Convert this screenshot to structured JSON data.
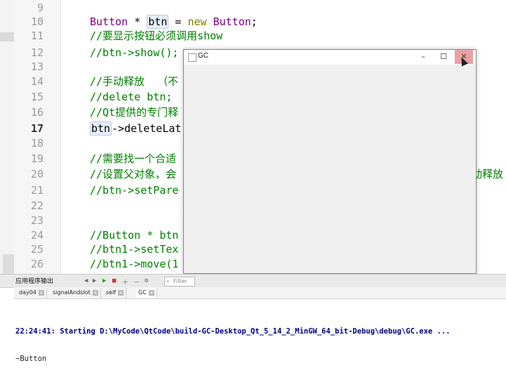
{
  "editor": {
    "line_numbers": [
      "9",
      "10",
      "11",
      "12",
      "13",
      "14",
      "15",
      "16",
      "17",
      "18",
      "19",
      "20",
      "21",
      "22",
      "23",
      "24",
      "25",
      "26"
    ],
    "current_line": "17",
    "lines": {
      "l10_type": "Button",
      "l10_op1": " * ",
      "l10_var": "btn",
      "l10_op2": " = ",
      "l10_new": "new",
      "l10_type2": " Button",
      "l10_end": ";",
      "l11": "//要显示按钮必须调用show",
      "l12": "//btn->show();",
      "l14": "//手动释放  （不",
      "l15": "//delete btn;",
      "l16": "//Qt提供的专门释",
      "l17_var": "btn",
      "l17_rest": "->deleteLat",
      "l19": "//需要找一个合适",
      "l20": "//设置父对象，会",
      "l20_tail": "动释放",
      "l21": "//btn->setPare",
      "l24": "//Button * btn",
      "l25": "//btn1->setTex",
      "l26": "//btn1->move(1"
    }
  },
  "gc_window": {
    "title": "GC",
    "minimize_label": "–",
    "maximize_label": "☐",
    "close_label": "✕"
  },
  "output": {
    "pane_title": "应用程序输出",
    "filter_placeholder": "Filter",
    "tabs": [
      "day04",
      "signalAndslot",
      "self",
      "GC"
    ],
    "active_tab": "GC",
    "line1": "22:24:41: Starting D:\\MyCode\\QtCode\\build-GC-Desktop_Qt_5_14_2_MinGW_64_bit-Debug\\debug\\GC.exe ...",
    "line2": "~Button"
  }
}
